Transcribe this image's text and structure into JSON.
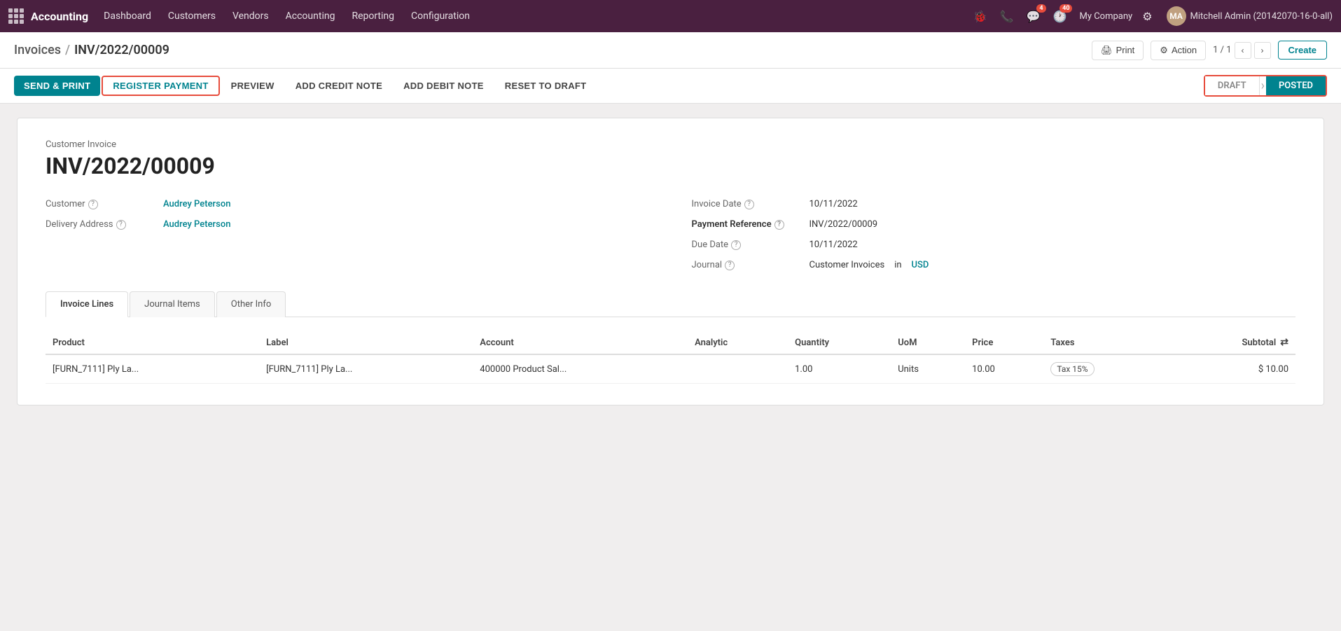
{
  "topnav": {
    "brand": "Accounting",
    "nav_items": [
      "Dashboard",
      "Customers",
      "Vendors",
      "Accounting",
      "Reporting",
      "Configuration"
    ],
    "badge_messages": "4",
    "badge_activity": "40",
    "company": "My Company",
    "user": "Mitchell Admin (20142070-16-0-all)"
  },
  "breadcrumb": {
    "parent": "Invoices",
    "current": "INV/2022/00009",
    "print_label": "Print",
    "action_label": "Action",
    "page_info": "1 / 1",
    "create_label": "Create"
  },
  "action_bar": {
    "send_print": "SEND & PRINT",
    "register_payment": "REGISTER PAYMENT",
    "preview": "PREVIEW",
    "add_credit_note": "ADD CREDIT NOTE",
    "add_debit_note": "ADD DEBIT NOTE",
    "reset_to_draft": "RESET TO DRAFT"
  },
  "status_steps": [
    {
      "label": "DRAFT",
      "active": false
    },
    {
      "label": "POSTED",
      "active": true
    }
  ],
  "invoice": {
    "type_label": "Customer Invoice",
    "number": "INV/2022/00009",
    "customer_label": "Customer",
    "customer_value": "Audrey Peterson",
    "delivery_address_label": "Delivery Address",
    "delivery_address_value": "Audrey Peterson",
    "invoice_date_label": "Invoice Date",
    "invoice_date_value": "10/11/2022",
    "payment_reference_label": "Payment Reference",
    "payment_reference_value": "INV/2022/00009",
    "due_date_label": "Due Date",
    "due_date_value": "10/11/2022",
    "journal_label": "Journal",
    "journal_value": "Customer Invoices",
    "journal_in": "in",
    "journal_currency": "USD"
  },
  "tabs": [
    {
      "label": "Invoice Lines",
      "active": true
    },
    {
      "label": "Journal Items",
      "active": false
    },
    {
      "label": "Other Info",
      "active": false
    }
  ],
  "table": {
    "columns": [
      "Product",
      "Label",
      "Account",
      "Analytic",
      "Quantity",
      "UoM",
      "Price",
      "Taxes",
      "Subtotal"
    ],
    "rows": [
      {
        "product": "[FURN_7111] Ply La...",
        "label": "[FURN_7111] Ply La...",
        "account": "400000 Product Sal...",
        "analytic": "",
        "quantity": "1.00",
        "uom": "Units",
        "price": "10.00",
        "taxes": "Tax 15%",
        "subtotal": "$ 10.00"
      }
    ]
  }
}
